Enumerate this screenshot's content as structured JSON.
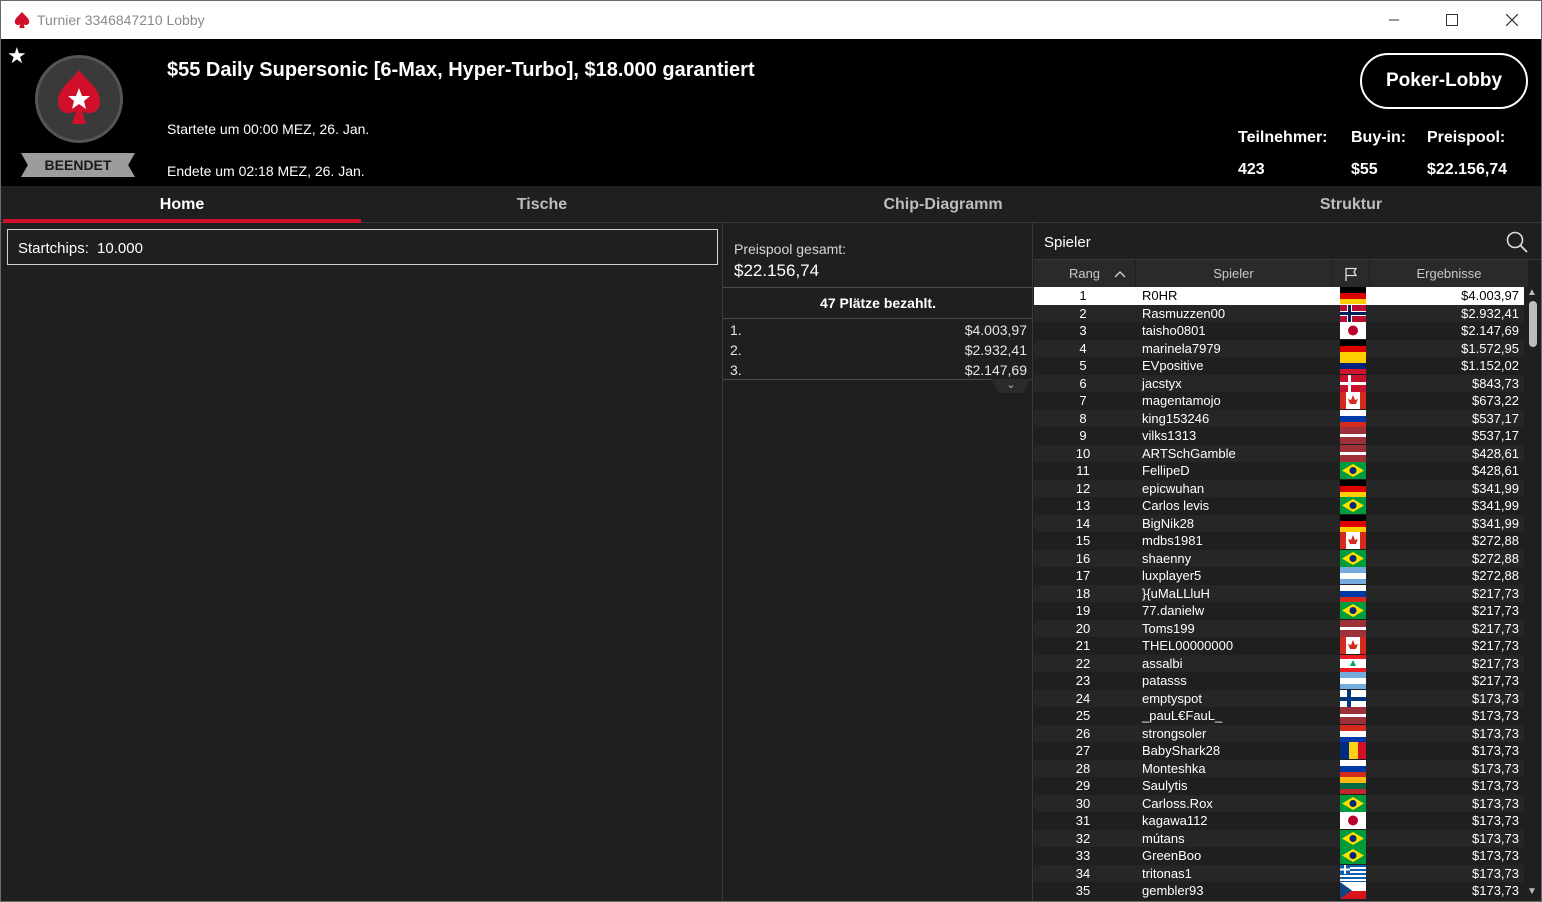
{
  "window": {
    "title": "Turnier 3346847210 Lobby",
    "brand_color": "#d0102a"
  },
  "header": {
    "status": "BEENDET",
    "tournament_title": "$55 Daily Supersonic [6-Max, Hyper-Turbo], $18.000 garantiert",
    "started": "Startete um 00:00 MEZ, 26. Jan.",
    "ended": "Endete um 02:18 MEZ, 26. Jan.",
    "lobby_button": "Poker-Lobby",
    "stats": {
      "participants_label": "Teilnehmer:",
      "participants_value": "423",
      "buyin_label": "Buy-in:",
      "buyin_value": "$55",
      "prizepool_label": "Preispool:",
      "prizepool_value": "$22.156,74"
    }
  },
  "tabs": [
    {
      "label": "Home",
      "active": true
    },
    {
      "label": "Tische",
      "active": false
    },
    {
      "label": "Chip-Diagramm",
      "active": false
    },
    {
      "label": "Struktur",
      "active": false
    }
  ],
  "home": {
    "startchips_label": "Startchips:",
    "startchips_value": "10.000"
  },
  "prizes": {
    "total_label": "Preispool gesamt:",
    "total_value": "$22.156,74",
    "paid_places": "47 Plätze bezahlt.",
    "payouts": [
      {
        "place": "1.",
        "amount": "$4.003,97"
      },
      {
        "place": "2.",
        "amount": "$2.932,41"
      },
      {
        "place": "3.",
        "amount": "$2.147,69"
      }
    ]
  },
  "players": {
    "search_label": "Spieler",
    "columns": {
      "rank": "Rang",
      "player": "Spieler",
      "results": "Ergebnisse"
    },
    "rows": [
      {
        "rank": "1",
        "name": "R0HR",
        "flag": "de",
        "amount": "$4.003,97"
      },
      {
        "rank": "2",
        "name": "Rasmuzzen00",
        "flag": "no",
        "amount": "$2.932,41"
      },
      {
        "rank": "3",
        "name": "taisho0801",
        "flag": "jp",
        "amount": "$2.147,69"
      },
      {
        "rank": "4",
        "name": "marinela7979",
        "flag": "de",
        "amount": "$1.572,95"
      },
      {
        "rank": "5",
        "name": "EVpositive",
        "flag": "ve",
        "amount": "$1.152,02"
      },
      {
        "rank": "6",
        "name": "jacstyx",
        "flag": "dk",
        "amount": "$843,73"
      },
      {
        "rank": "7",
        "name": "magentamojo",
        "flag": "ca",
        "amount": "$673,22"
      },
      {
        "rank": "8",
        "name": "king153246",
        "flag": "ru",
        "amount": "$537,17"
      },
      {
        "rank": "9",
        "name": "vilks1313",
        "flag": "lv",
        "amount": "$537,17"
      },
      {
        "rank": "10",
        "name": "ARTSchGamble",
        "flag": "lv",
        "amount": "$428,61"
      },
      {
        "rank": "11",
        "name": "FellipeD",
        "flag": "br",
        "amount": "$428,61"
      },
      {
        "rank": "12",
        "name": "epicwuhan",
        "flag": "de",
        "amount": "$341,99"
      },
      {
        "rank": "13",
        "name": "Carlos levis",
        "flag": "br",
        "amount": "$341,99"
      },
      {
        "rank": "14",
        "name": "BigNik28",
        "flag": "de",
        "amount": "$341,99"
      },
      {
        "rank": "15",
        "name": "mdbs1981",
        "flag": "ca",
        "amount": "$272,88"
      },
      {
        "rank": "16",
        "name": "shaenny",
        "flag": "br",
        "amount": "$272,88"
      },
      {
        "rank": "17",
        "name": "luxplayer5",
        "flag": "ar",
        "amount": "$272,88"
      },
      {
        "rank": "18",
        "name": "}{uMaLLluH",
        "flag": "ru",
        "amount": "$217,73"
      },
      {
        "rank": "19",
        "name": "77.danielw",
        "flag": "br",
        "amount": "$217,73"
      },
      {
        "rank": "20",
        "name": "Toms199",
        "flag": "lv",
        "amount": "$217,73"
      },
      {
        "rank": "21",
        "name": "THEL00000000",
        "flag": "ca",
        "amount": "$217,73"
      },
      {
        "rank": "22",
        "name": "assalbi",
        "flag": "lb",
        "amount": "$217,73"
      },
      {
        "rank": "23",
        "name": "patasss",
        "flag": "ar",
        "amount": "$217,73"
      },
      {
        "rank": "24",
        "name": "emptyspot",
        "flag": "fi",
        "amount": "$173,73"
      },
      {
        "rank": "25",
        "name": "_pauL€FauL_",
        "flag": "lv",
        "amount": "$173,73"
      },
      {
        "rank": "26",
        "name": "strongsoler",
        "flag": "py",
        "amount": "$173,73"
      },
      {
        "rank": "27",
        "name": "BabyShark28",
        "flag": "ro",
        "amount": "$173,73"
      },
      {
        "rank": "28",
        "name": "Monteshka",
        "flag": "ru",
        "amount": "$173,73"
      },
      {
        "rank": "29",
        "name": "Saulytis",
        "flag": "lt",
        "amount": "$173,73"
      },
      {
        "rank": "30",
        "name": "Carloss.Rox",
        "flag": "br",
        "amount": "$173,73"
      },
      {
        "rank": "31",
        "name": "kagawa112",
        "flag": "jp",
        "amount": "$173,73"
      },
      {
        "rank": "32",
        "name": "mútans",
        "flag": "br",
        "amount": "$173,73"
      },
      {
        "rank": "33",
        "name": "GreenBoo",
        "flag": "br",
        "amount": "$173,73"
      },
      {
        "rank": "34",
        "name": "tritonas1",
        "flag": "gr",
        "amount": "$173,73"
      },
      {
        "rank": "35",
        "name": "gembler93",
        "flag": "cz",
        "amount": "$173,73"
      }
    ]
  }
}
